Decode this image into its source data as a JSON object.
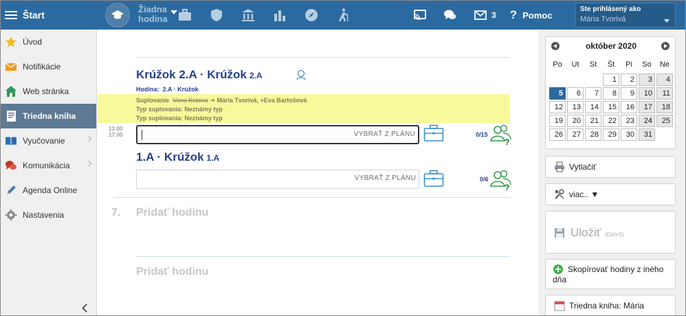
{
  "topbar": {
    "title": "Štart",
    "lesson_select_line1": "Žiadna",
    "lesson_select_line2": "hodina",
    "message_count": "3",
    "help_label": "Pomoc",
    "user_label": "Ste prihlásený ako",
    "user_name": "Mária Tvorivá"
  },
  "sidebar": {
    "items": [
      {
        "label": "Úvod",
        "icon": "star-icon"
      },
      {
        "label": "Notifikácie",
        "icon": "envelope-icon"
      },
      {
        "label": "Web stránka",
        "icon": "house-icon"
      },
      {
        "label": "Triedna kniha",
        "icon": "book-icon"
      },
      {
        "label": "Vyučovanie",
        "icon": "open-book-icon"
      },
      {
        "label": "Komunikácia",
        "icon": "chat-icon"
      },
      {
        "label": "Agenda Online",
        "icon": "pencil-icon"
      },
      {
        "label": "Nastavenia",
        "icon": "gear-icon"
      }
    ]
  },
  "lesson1": {
    "title": "Krúžok  2.A · Krúžok",
    "class": "2.A",
    "meta_label": "Hodina:",
    "meta_value": "2.A · Krúžok",
    "subst_label": "Suplovanie",
    "subst_old": "Viera Krásna",
    "subst_new": "➔ Mária Tvorivá, +Eva Bartošová",
    "subst_type1": "Typ suplovania:  Neznámy typ",
    "subst_type2": "Typ suplovania:  Neznámy typ",
    "time_start": "13:00",
    "time_end": "17:00",
    "plan_placeholder": "VYBRAŤ Z PLÁNU",
    "count": "0/15"
  },
  "lesson2": {
    "title": "1.A · Krúžok",
    "class": "1.A",
    "plan_placeholder": "VYBRAŤ Z PLÁNU",
    "count": "0/6"
  },
  "add_rows": [
    {
      "number": "7.",
      "label": "Pridať hodinu"
    },
    {
      "number": "",
      "label": "Pridať hodinu"
    }
  ],
  "calendar": {
    "month": "október 2020",
    "dow": [
      "Po",
      "Ut",
      "St",
      "Št",
      "Pi",
      "So",
      "Ne"
    ],
    "leading_blanks": 3,
    "days": [
      "1",
      "2",
      "3",
      "4",
      "5",
      "6",
      "7",
      "8",
      "9",
      "10",
      "11",
      "12",
      "13",
      "14",
      "15",
      "16",
      "17",
      "18",
      "19",
      "20",
      "21",
      "22",
      "23",
      "24",
      "25",
      "26",
      "27",
      "28",
      "29",
      "30",
      "31"
    ],
    "selected": "5"
  },
  "right_buttons": {
    "print": "Vytlačiť",
    "more": "viac.. ▼",
    "save": "Uložiť",
    "save_hint": "(Ctrl+S)",
    "copy": "Skopírovať hodiny z iného dňa",
    "book": "Triedna kniha: Mária"
  },
  "colors": {
    "topbar": "#2b6aa0",
    "lesson_text": "#243f8f",
    "substitution_band": "#f8f99a",
    "selected_day": "#2b6aa0"
  }
}
